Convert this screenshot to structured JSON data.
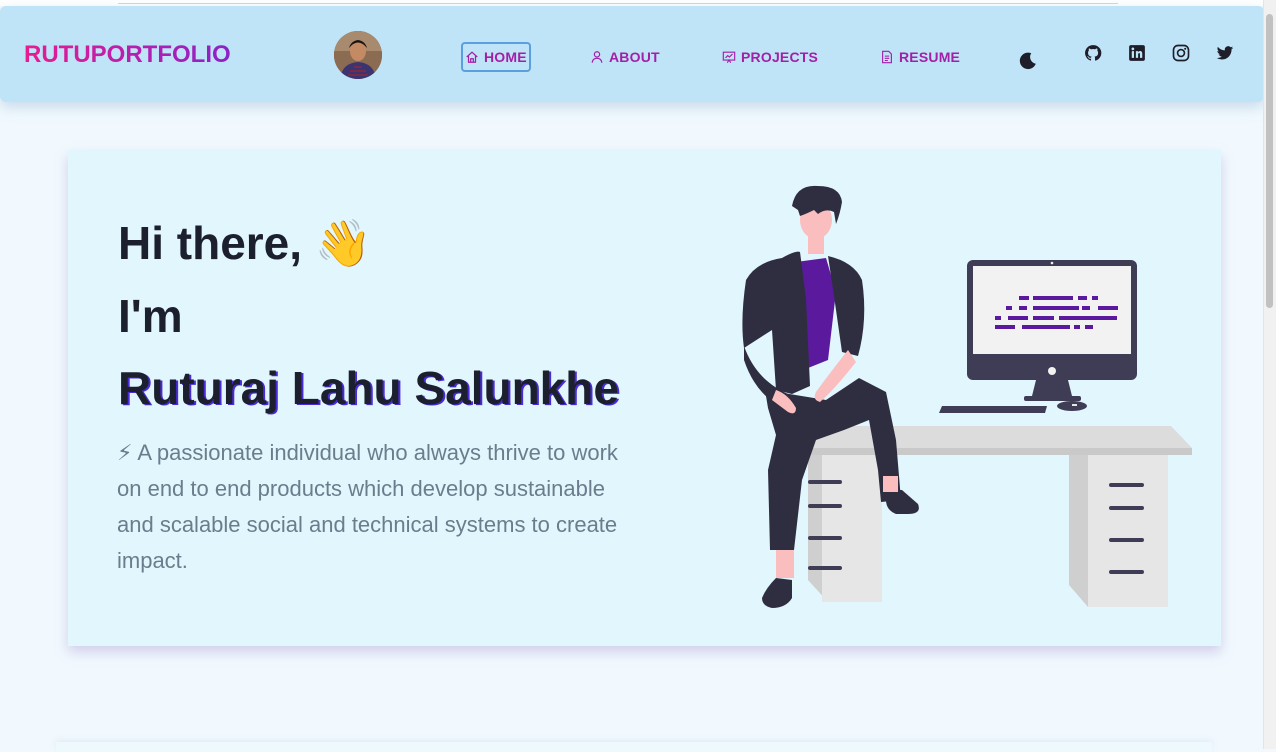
{
  "navbar": {
    "logo": "RUTUPORTFOLIO",
    "links": [
      {
        "label": "HOME",
        "icon": "home-icon",
        "active": true
      },
      {
        "label": "ABOUT",
        "icon": "user-icon",
        "active": false
      },
      {
        "label": "PROJECTS",
        "icon": "presentation-icon",
        "active": false
      },
      {
        "label": "RESUME",
        "icon": "document-icon",
        "active": false
      }
    ],
    "theme_toggle_icon": "moon-icon",
    "social_icons": [
      "github-icon",
      "linkedin-icon",
      "instagram-icon",
      "twitter-icon"
    ]
  },
  "hero": {
    "greeting": "Hi there, 👋",
    "intro": "I'm",
    "name": "Ruturaj Lahu Salunkhe",
    "description": "⚡ A passionate individual who always thrive to work on end to end products which develop sustainable and scalable social and technical systems to create impact.",
    "illustration_icon": "developer-at-desk-illustration"
  },
  "colors": {
    "navbar_bg": "#bfe3f7",
    "page_bg": "#f1f9fe",
    "hero_bg": "#e1f6fd",
    "accent": "#a31fa8",
    "logo_gradient_start": "#e81c8f",
    "logo_gradient_end": "#8a23c8",
    "heading": "#1c1f2e",
    "body_text": "#6b7d8c",
    "code_accent": "#5b1a9e"
  }
}
